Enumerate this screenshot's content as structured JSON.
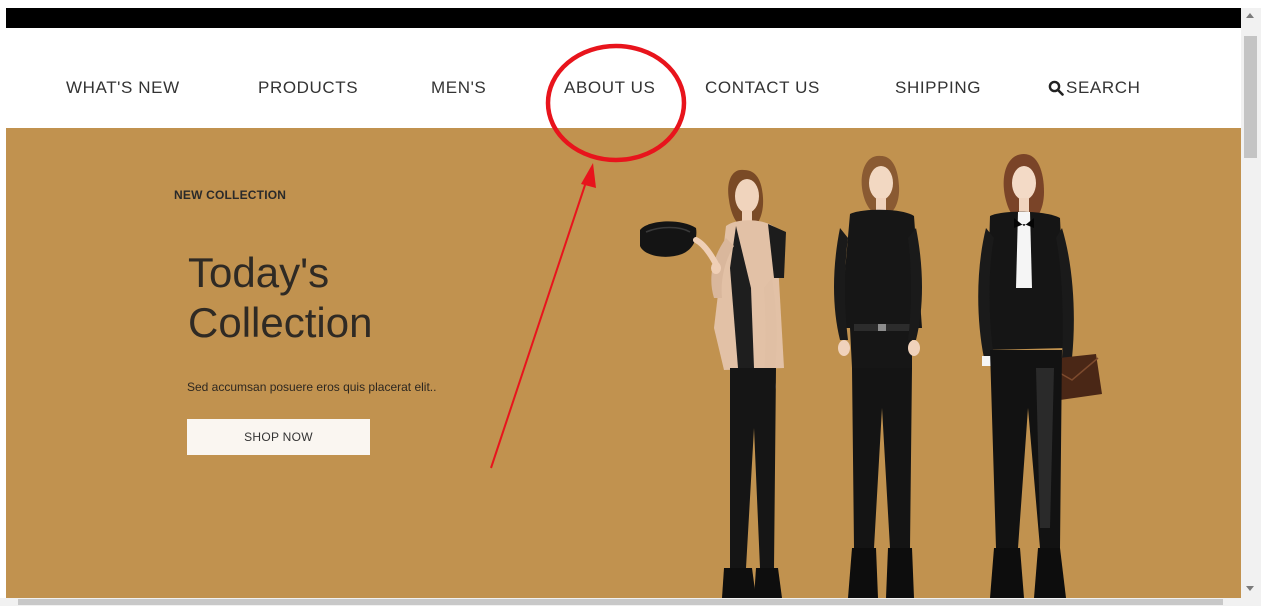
{
  "nav": {
    "items": [
      {
        "label": "WHAT'S NEW"
      },
      {
        "label": "PRODUCTS"
      },
      {
        "label": "MEN'S"
      },
      {
        "label": "ABOUT US"
      },
      {
        "label": "CONTACT US"
      },
      {
        "label": "SHIPPING"
      }
    ],
    "search_label": "SEARCH",
    "search_icon": "search-icon"
  },
  "hero": {
    "kicker": "NEW COLLECTION",
    "headline_line1": "Today's",
    "headline_line2": "Collection",
    "subtext": "Sed accumsan posuere eros quis placerat elit..",
    "button_label": "SHOP NOW",
    "background_color": "#c1924f"
  },
  "annotation": {
    "color": "#e8141c",
    "target": "ABOUT US"
  }
}
